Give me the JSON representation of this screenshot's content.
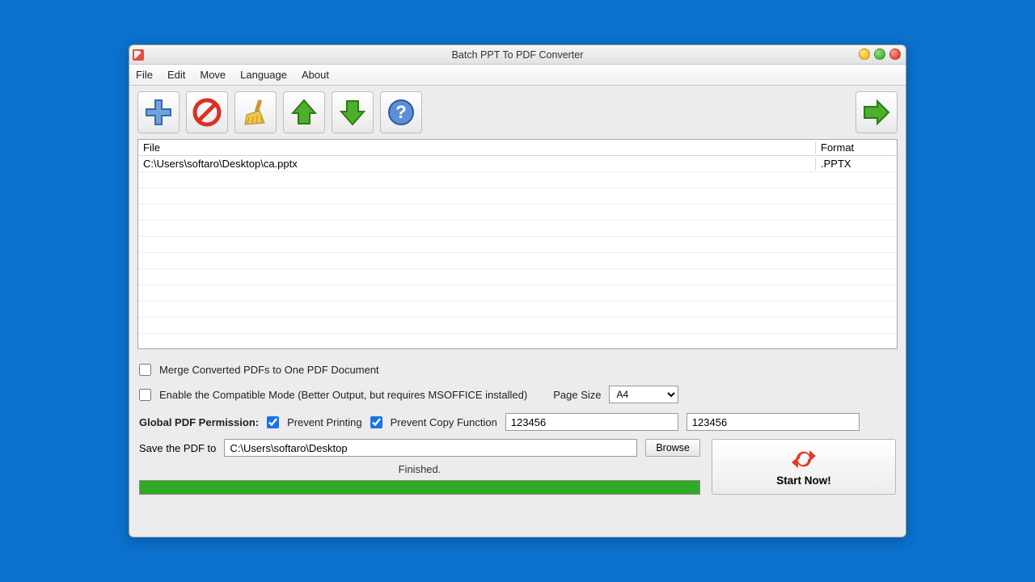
{
  "window": {
    "title": "Batch PPT To PDF Converter"
  },
  "menu": {
    "file": "File",
    "edit": "Edit",
    "move": "Move",
    "language": "Language",
    "about": "About"
  },
  "list": {
    "header_file": "File",
    "header_format": "Format",
    "rows": [
      {
        "file": "C:\\Users\\softaro\\Desktop\\ca.pptx",
        "format": ".PPTX"
      }
    ]
  },
  "options": {
    "merge_label": "Merge Converted PDFs to One PDF Document",
    "merge_checked": false,
    "compat_label": "Enable the Compatible Mode (Better Output, but requires MSOFFICE installed)",
    "compat_checked": false,
    "page_size_label": "Page Size",
    "page_size_value": "A4",
    "perm_label": "Global PDF Permission:",
    "prevent_print_label": "Prevent Printing",
    "prevent_print_checked": true,
    "prevent_copy_label": "Prevent Copy Function",
    "prevent_copy_checked": true,
    "password1": "123456",
    "password2": "123456"
  },
  "save": {
    "label": "Save the PDF to",
    "path": "C:\\Users\\softaro\\Desktop",
    "browse": "Browse"
  },
  "status": {
    "text": "Finished.",
    "progress_percent": 100
  },
  "start": {
    "label": "Start Now!"
  },
  "icons": {
    "add": "plus-icon",
    "remove": "no-entry-icon",
    "clear": "broom-icon",
    "up": "arrow-up-icon",
    "down": "arrow-down-icon",
    "help": "help-icon",
    "go": "arrow-right-icon",
    "refresh": "refresh-icon"
  }
}
